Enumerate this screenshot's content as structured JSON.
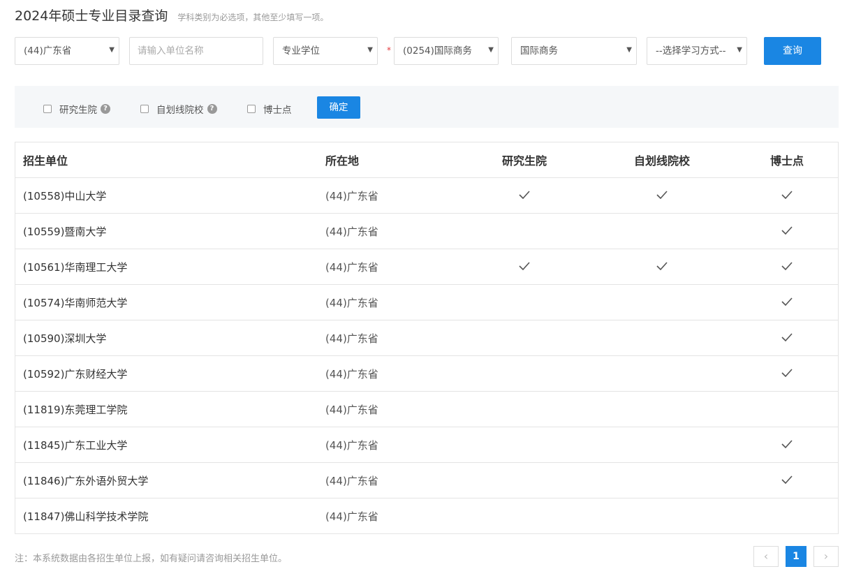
{
  "header": {
    "title": "2024年硕士专业目录查询",
    "subtitle": "学科类别为必选项，其他至少填写一项。"
  },
  "filters": {
    "province": "(44)广东省",
    "unit_placeholder": "请输入单位名称",
    "degree_type": "专业学位",
    "required_mark": "*",
    "discipline": "(0254)国际商务",
    "major": "国际商务",
    "study_mode": "--选择学习方式--",
    "query_label": "查询"
  },
  "options": {
    "grad_school": "研究生院",
    "self_line": "自划线院校",
    "doctoral": "博士点",
    "help_glyph": "?",
    "confirm_label": "确定"
  },
  "table": {
    "columns": [
      "招生单位",
      "所在地",
      "研究生院",
      "自划线院校",
      "博士点"
    ],
    "rows": [
      {
        "unit": "(10558)中山大学",
        "location": "(44)广东省",
        "grad_school": true,
        "self_line": true,
        "doctoral": true
      },
      {
        "unit": "(10559)暨南大学",
        "location": "(44)广东省",
        "grad_school": false,
        "self_line": false,
        "doctoral": true
      },
      {
        "unit": "(10561)华南理工大学",
        "location": "(44)广东省",
        "grad_school": true,
        "self_line": true,
        "doctoral": true
      },
      {
        "unit": "(10574)华南师范大学",
        "location": "(44)广东省",
        "grad_school": false,
        "self_line": false,
        "doctoral": true
      },
      {
        "unit": "(10590)深圳大学",
        "location": "(44)广东省",
        "grad_school": false,
        "self_line": false,
        "doctoral": true
      },
      {
        "unit": "(10592)广东财经大学",
        "location": "(44)广东省",
        "grad_school": false,
        "self_line": false,
        "doctoral": true
      },
      {
        "unit": "(11819)东莞理工学院",
        "location": "(44)广东省",
        "grad_school": false,
        "self_line": false,
        "doctoral": false
      },
      {
        "unit": "(11845)广东工业大学",
        "location": "(44)广东省",
        "grad_school": false,
        "self_line": false,
        "doctoral": true
      },
      {
        "unit": "(11846)广东外语外贸大学",
        "location": "(44)广东省",
        "grad_school": false,
        "self_line": false,
        "doctoral": true
      },
      {
        "unit": "(11847)佛山科学技术学院",
        "location": "(44)广东省",
        "grad_school": false,
        "self_line": false,
        "doctoral": false
      }
    ]
  },
  "footer": {
    "note": "注：本系统数据由各招生单位上报，如有疑问请咨询相关招生单位。",
    "prev": "‹",
    "current_page": "1",
    "next": "›"
  },
  "icons": {
    "select_arrow": "▼"
  },
  "colors": {
    "accent": "#1a86e3",
    "required": "#e4393c"
  }
}
